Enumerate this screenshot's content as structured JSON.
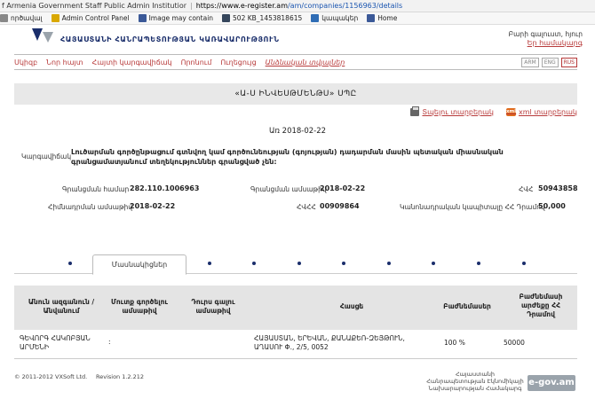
{
  "browser": {
    "tab_title": "f Armenia Government Staff Public Admin Institution [AM]",
    "url_scheme_host": "https://www.e-register.am",
    "url_path": "/am/companies/1156963/details"
  },
  "bookmarks": [
    {
      "label": "ործավալ",
      "icon": "bookmark-icon",
      "color": "#888888"
    },
    {
      "label": "Admin Control Panel",
      "icon": "admin-icon",
      "color": "#d9a800"
    },
    {
      "label": "Image may contain",
      "icon": "facebook-icon",
      "color": "#3b5998"
    },
    {
      "label": "502 KB_1453818615",
      "icon": "tumblr-icon",
      "color": "#35465c"
    },
    {
      "label": "կապակեր",
      "icon": "edge-icon",
      "color": "#2f6db5"
    },
    {
      "label": "Home",
      "icon": "facebook-icon",
      "color": "#3b5998"
    }
  ],
  "header": {
    "agency": "ՀԱՅԱՍՏԱՆԻ ՀԱՆՐԱՊԵՏՈՒԹՅԱՆ ԿԱՌԱՎԱՐՈՒԹՅՈՒՆ",
    "user_text": "Բարի գալուստ, հյուր",
    "login_link": "Եր համակարգ"
  },
  "nav": {
    "items": [
      {
        "label": "Սկիզբ",
        "active": false
      },
      {
        "label": "Նոր հայտ",
        "active": false
      },
      {
        "label": "Հայտի կարգավիճակ",
        "active": false
      },
      {
        "label": "Որոնում",
        "active": false
      },
      {
        "label": "Ուղեցույց",
        "active": false
      },
      {
        "label": "Անձնական տվյալներ",
        "active": true
      }
    ],
    "langs": [
      {
        "label": "ARM",
        "selected": false
      },
      {
        "label": "ENG",
        "selected": false
      },
      {
        "label": "RUS",
        "selected": true
      }
    ]
  },
  "company": {
    "name": "«Ա-Ս ԻՆՎԵՍԹՄԵՆԹՍ» ՍՊԸ",
    "print_link": "Տպելու տարբերակ",
    "xml_link": "xml տարբերակ",
    "xml_badge": "xml",
    "date_line": "Առ 2018-02-22",
    "activity_label": "Կարգավիճակ",
    "activity_text": "Լուծարման գործընթացում գտնվող կամ գործունեության (գոյության) դադարման մասին պետական միասնական գրանցամատյանում տեղեկություններ գրանցված չեն:",
    "fields": {
      "reg_number_label": "Գրանցման համար",
      "reg_number": "282.110.1006963",
      "reg_date_label": "Գրանցման ամսաթիվ",
      "reg_date": "2018-02-22",
      "tin_label": "ՀՎՀ",
      "tin": "50943858",
      "founding_date_label": "Հիմնադրման ամսաթիվ",
      "founding_date": "2018-02-22",
      "vat_label": "ՀՎՀՀ",
      "vat": "00909864",
      "capital_label": "Կանոնադրական կապիտալը ՀՀ Դրամով",
      "capital": "50,000"
    }
  },
  "tabs": {
    "active_label": "Մասնակիցներ",
    "dot_count": 9
  },
  "table": {
    "headers": [
      "Անուն ազգանուն / Անվանում",
      "Մուտք գործելու ամսաթիվ",
      "Դուրս գալու ամսաթիվ",
      "Հասցե",
      "Բաժնեմասեր",
      "Բաժնեմասի արժեքը ՀՀ Դրամով"
    ],
    "rows": [
      {
        "name": "ԳԵՎՈՐԳ ՀԱԿՈԲՅԱՆ ԱՐՄԵՆԻ",
        "entry_date": ":",
        "exit_date": "",
        "address": "ՀԱՅԱՍՏԱՆ, ԵՐԵՎԱՆ, ՔԱՆԱՔԵՌ-ԶԵՅԹՈՒՆ, ԱՂԱՍՈՒ Փ., 2/5, 0052",
        "shares": "100 %",
        "share_value": "50000"
      }
    ]
  },
  "footer": {
    "copyright": "© 2011-2012 VXSoft Ltd.",
    "revision": "Revision 1.2.212",
    "ministry": "Հայաստանի Հանրապետության Էկնոմիկայի Նախարարության Համակարգ",
    "egov_label": "e-gov.am"
  },
  "colors": {
    "link_red": "#b83a3a",
    "navy": "#1a2e6b",
    "bar_gray": "#e8e8e8"
  }
}
